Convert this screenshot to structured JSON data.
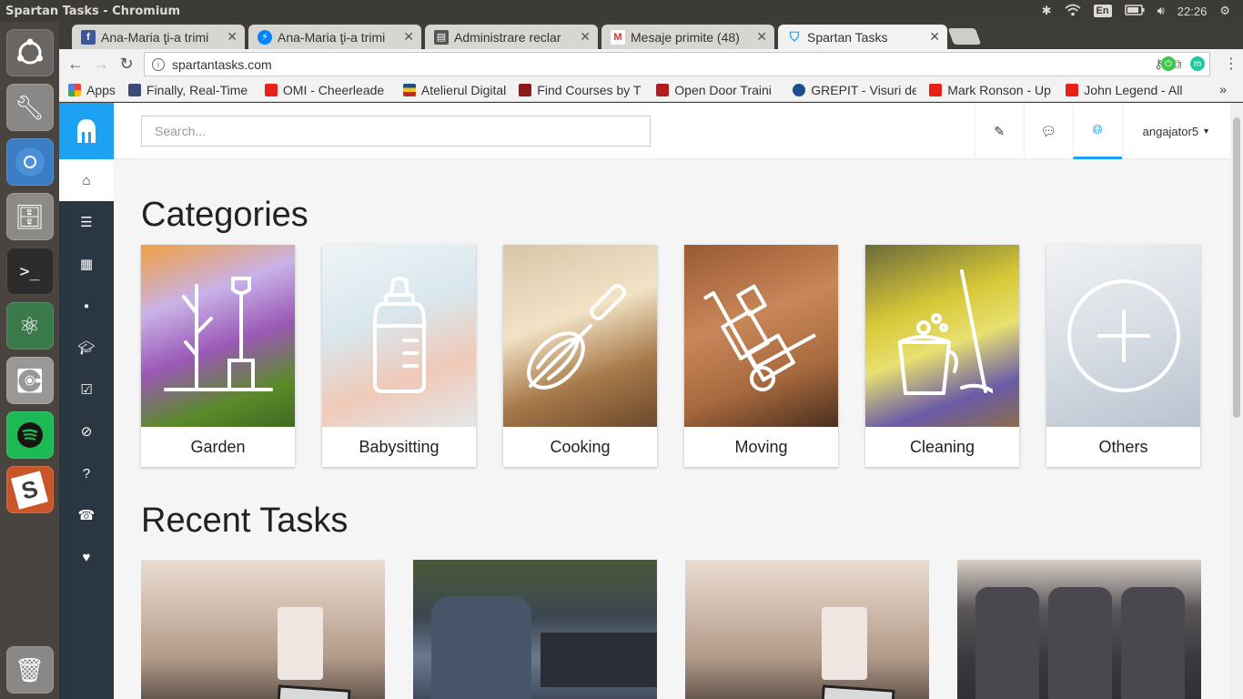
{
  "os": {
    "window_title": "Spartan Tasks - Chromium",
    "keyboard_layout": "En",
    "clock": "22:26"
  },
  "browser": {
    "tabs": [
      {
        "title": "Ana-Maria ţi-a trimi",
        "favicon": "facebook-icon",
        "color": "#3b5998"
      },
      {
        "title": "Ana-Maria ţi-a trimi",
        "favicon": "messenger-icon",
        "color": "#0084ff"
      },
      {
        "title": "Administrare reclar",
        "favicon": "document-icon",
        "color": "#555555"
      },
      {
        "title": "Mesaje primite (48)",
        "favicon": "gmail-icon",
        "color": "#d93025"
      },
      {
        "title": "Spartan Tasks",
        "favicon": "spartan-icon",
        "color": "#1da1f2"
      }
    ],
    "url": "spartantasks.com",
    "bookmarks": [
      {
        "label": "Apps",
        "color": "#e8453c"
      },
      {
        "label": "Finally, Real-Time",
        "color": "#3c4a7a"
      },
      {
        "label": "OMI - Cheerleade",
        "color": "#e62117"
      },
      {
        "label": "Atelierul Digital",
        "color": "#c62828"
      },
      {
        "label": "Find Courses by T",
        "color": "#8b1a1a"
      },
      {
        "label": "Open Door Traini",
        "color": "#b71c1c"
      },
      {
        "label": "GREPIT - Visuri de",
        "color": "#1a4f8b"
      },
      {
        "label": "Mark Ronson - Up",
        "color": "#e62117"
      },
      {
        "label": "John Legend - All",
        "color": "#e62117"
      }
    ],
    "bookmarks_more": "»"
  },
  "app": {
    "search_placeholder": "Search...",
    "user_menu": "angajator5",
    "sidebar_icons": [
      "home-icon",
      "server-icon",
      "table-icon",
      "comment-icon",
      "graduation-cap-icon",
      "check-square-icon",
      "ban-icon",
      "question-icon",
      "phone-icon",
      "heart-icon"
    ],
    "header_icons": [
      "edit-icon",
      "chat-icon",
      "globe-icon"
    ],
    "accent_color": "#1da1f2",
    "sidebar_color": "#2b3643"
  },
  "categories": {
    "title": "Categories",
    "items": [
      {
        "label": "Garden",
        "icon": "plant-icon",
        "bg": "linear-gradient(160deg,#f0a040 0%,#c9b2e8 30%,#9b59b6 55%,#5a8a2a 80%,#3f6a20 100%)"
      },
      {
        "label": "Babysitting",
        "icon": "baby-bottle-icon",
        "bg": "linear-gradient(160deg,#eef4f6 0%,#d9e7ee 40%,#f0c9b8 70%,#e2e8ea 100%)"
      },
      {
        "label": "Cooking",
        "icon": "whisk-icon",
        "bg": "linear-gradient(160deg,#d8c5a8 0%,#f2e3c6 40%,#a8794a 70%,#6b4a2c 100%)"
      },
      {
        "label": "Moving",
        "icon": "hand-truck-icon",
        "bg": "linear-gradient(160deg,#9a5a30 0%,#c8875a 40%,#a86a3e 70%,#4a3020 100%)"
      },
      {
        "label": "Cleaning",
        "icon": "bucket-mop-icon",
        "bg": "linear-gradient(160deg,#6b6a3a 0%,#d8c838 35%,#e8e070 55%,#6a5aa8 80%,#8a6f4a 100%)"
      },
      {
        "label": "Others",
        "icon": "plus-circle-icon",
        "bg": "linear-gradient(160deg,#f0f2f5 0%,#d8dde4 50%,#b8c2cf 100%)"
      }
    ]
  },
  "recent_tasks": {
    "title": "Recent Tasks",
    "items": [
      {
        "image": "desk-mug-photo",
        "bg": "linear-gradient(180deg,#e9dcd0 0%,#cbb7a8 35%,#b09a88 60%,#3a302c 100%)"
      },
      {
        "image": "car-interior-photo",
        "bg": "linear-gradient(180deg,#4a5a3a 0%,#3c4650 35%,#6a7a90 60%,#2a3040 100%)"
      },
      {
        "image": "desk-mug-photo",
        "bg": "linear-gradient(180deg,#e9dcd0 0%,#cbb7a8 35%,#b09a88 60%,#3a302c 100%)"
      },
      {
        "image": "car-back-seat-photo",
        "bg": "linear-gradient(180deg,#d8d0c8 0%,#5a5658 30%,#3a3a3e 60%,#2a2a2e 100%)"
      }
    ]
  }
}
